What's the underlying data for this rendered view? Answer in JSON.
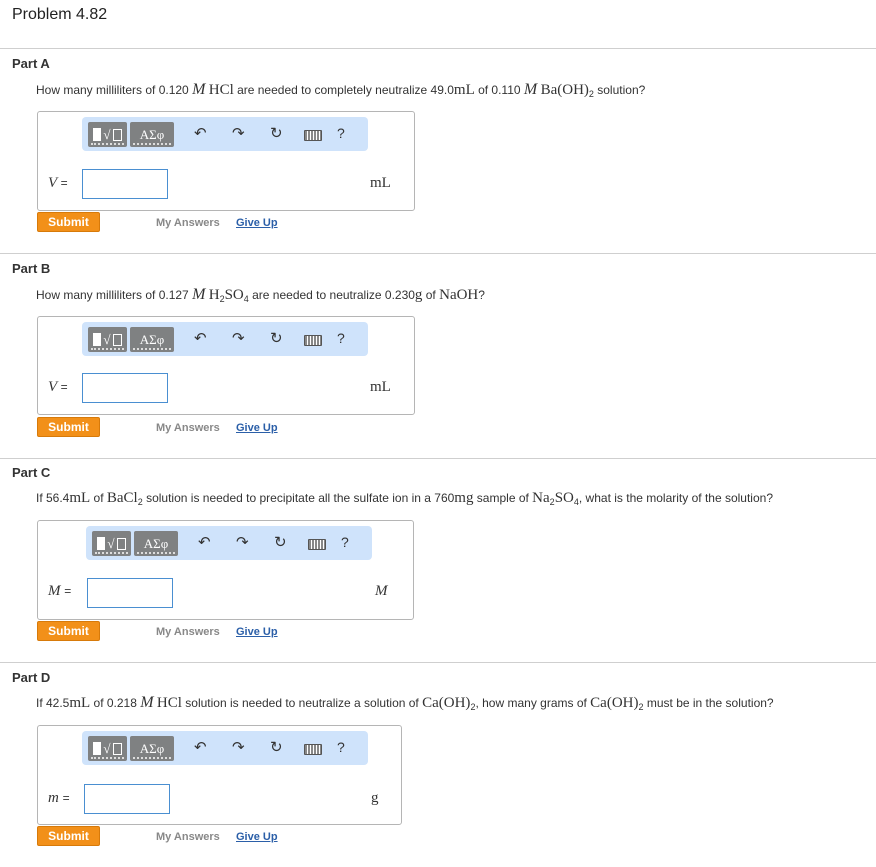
{
  "problem_title": "Problem 4.82",
  "toolbar": {
    "greek_label": "ΑΣφ",
    "help_label": "?",
    "icons": [
      "templates-icon",
      "symbols-icon",
      "undo-icon",
      "redo-icon",
      "reset-icon",
      "keyboard-icon",
      "help-icon"
    ]
  },
  "common": {
    "submit_label": "Submit",
    "my_answers_label": "My Answers",
    "give_up_label": "Give Up",
    "equals": "="
  },
  "parts": [
    {
      "label": "Part A",
      "question": {
        "t1": "How many milliliters of 0.120 ",
        "m1": "M",
        "c1": "HCl",
        "t2": " are needed to completely neutralize 49.0",
        "u1": "mL",
        "t3": " of 0.110 ",
        "m2": "M",
        "c2": "Ba(OH)",
        "s2": "2",
        "t4": " solution?"
      },
      "variable": "V",
      "input_value": "",
      "unit": "mL"
    },
    {
      "label": "Part B",
      "question": {
        "t1": "How many milliliters of 0.127 ",
        "m1": "M",
        "c1": "H",
        "s1": "2",
        "c1b": "SO",
        "s1b": "4",
        "t2": " are needed to neutralize 0.230",
        "u1": "g",
        "t3": " of ",
        "c2": "NaOH",
        "t4": "?"
      },
      "variable": "V",
      "input_value": "",
      "unit": "mL"
    },
    {
      "label": "Part C",
      "question": {
        "t1": "If 56.4",
        "u1": "mL",
        "t2": " of ",
        "c1": "BaCl",
        "s1": "2",
        "t3": " solution is needed to precipitate all the sulfate ion in a 760",
        "u2": "mg",
        "t4": " sample of ",
        "c2": "Na",
        "s2": "2",
        "c2b": "SO",
        "s2b": "4",
        "t5": ", what is the molarity of the solution?"
      },
      "variable": "M",
      "input_value": "",
      "unit": "M"
    },
    {
      "label": "Part D",
      "question": {
        "t1": "If 42.5",
        "u1": "mL",
        "t2": " of 0.218 ",
        "m1": "M",
        "c1": "HCl",
        "t3": " solution is needed to neutralize a solution of ",
        "c2": "Ca(OH)",
        "s2": "2",
        "t4": ", how many grams of ",
        "c3": "Ca(OH)",
        "s3": "2",
        "t5": " must be in the solution?"
      },
      "variable": "m",
      "input_value": "",
      "unit": "g"
    }
  ]
}
